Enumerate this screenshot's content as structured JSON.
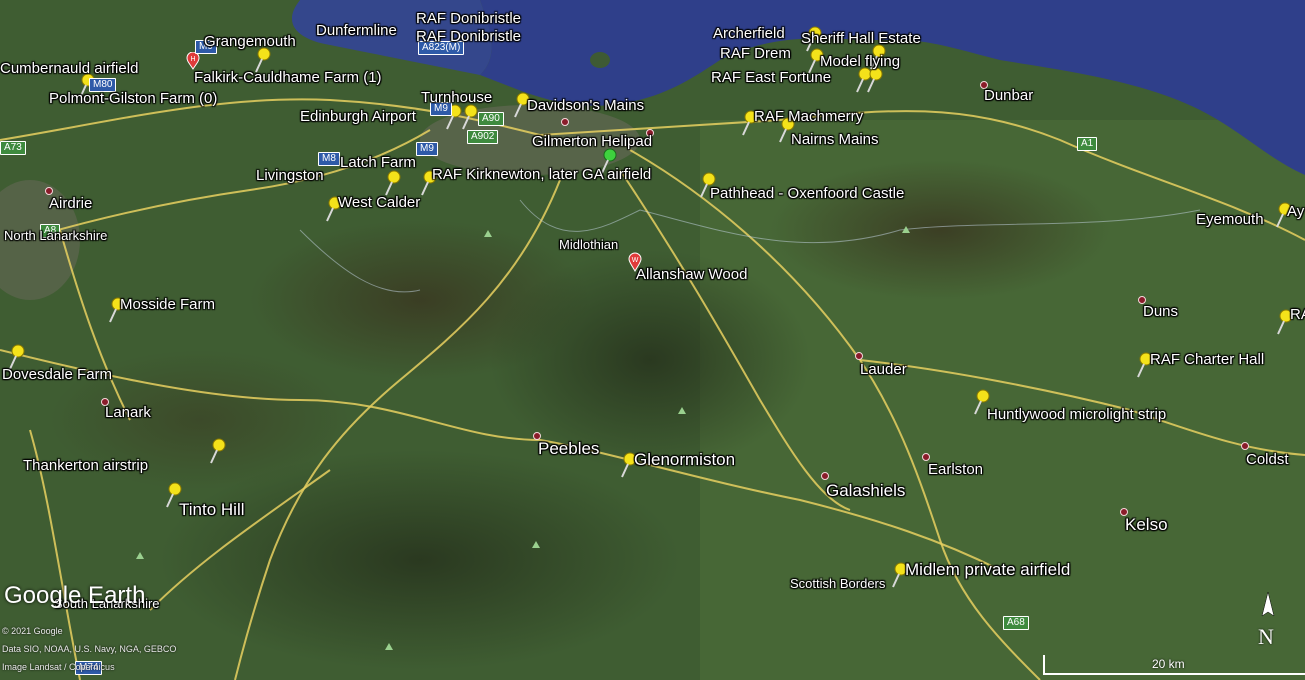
{
  "colors": {
    "sea": "#2f3f8a",
    "land": "#3c5a30",
    "road": "#e8d060",
    "pin": "#f4e21a",
    "town": "#8a1c2a",
    "badge": "#3e8a3e"
  },
  "places": {
    "grangemouth": "Grangemouth",
    "dunfermline": "Dunfermline",
    "raf_donibristle_1": "RAF Donibristle",
    "raf_donibristle_2": "RAF Donibristle",
    "archerfield": "Archerfield",
    "sheriff_hall": "Sheriff Hall Estate",
    "raf_drem": "RAF Drem",
    "model_flying": "Model flying",
    "raf_east_fortune": "RAF East Fortune",
    "dunbar": "Dunbar",
    "cumbernauld": "Cumbernauld airfield",
    "falkirk": "Falkirk-Cauldhame Farm (1)",
    "polmont": "Polmont-Gilston Farm (0)",
    "turnhouse": "Turnhouse",
    "davidsons_mains": "Davidson's Mains",
    "edinburgh_airport": "Edinburgh Airport",
    "raf_macmerry": "RAF Machmerry",
    "nairns_mains": "Nairns Mains",
    "gilmerton": "Gilmerton Helipad",
    "latch_farm": "Latch Farm",
    "livingston": "Livingston",
    "raf_kirknewton": "RAF Kirknewton, later GA airfield",
    "pathhead": "Pathhead - Oxenfoord Castle",
    "west_calder": "West Calder",
    "airdrie": "Airdrie",
    "north_lanarkshire": "North Lanarkshire",
    "eyemouth": "Eyemouth",
    "ay": "Ay",
    "midlothian": "Midlothian",
    "allanshaw": "Allanshaw Wood",
    "mosside": "Mosside Farm",
    "duns": "Duns",
    "ra": "RA",
    "dovesdale": "Dovesdale Farm",
    "lauder": "Lauder",
    "raf_charter_hall": "RAF Charter Hall",
    "lanark": "Lanark",
    "huntlywood": "Huntlywood microlight strip",
    "thankerton": "Thankerton airstrip",
    "peebles": "Peebles",
    "glenormiston": "Glenormiston",
    "earlston": "Earlston",
    "coldst": "Coldst",
    "tinto_hill": "Tinto Hill",
    "galashiels": "Galashiels",
    "kelso": "Kelso",
    "midlem": "Midlem private airfield",
    "scottish_borders": "Scottish Borders",
    "south_lanarkshire": "South Lanarkshire"
  },
  "roads": {
    "m80": "M80",
    "m9_top": "M9",
    "a823m": "A823(M)",
    "m9_mid": "M9",
    "a90": "A90",
    "a902": "A902",
    "m8": "M8",
    "m9_low": "M9",
    "a1": "A1",
    "a8": "A8",
    "a73": "A73",
    "a68": "A68",
    "m74": "M74"
  },
  "footer": {
    "logo": "Google Earth",
    "copyright": "© 2021 Google",
    "data": "Data SIO, NOAA, U.S. Navy, NGA, GEBCO",
    "image": "Image Landsat / Copernicus",
    "scale": "20 km",
    "north": "N"
  }
}
